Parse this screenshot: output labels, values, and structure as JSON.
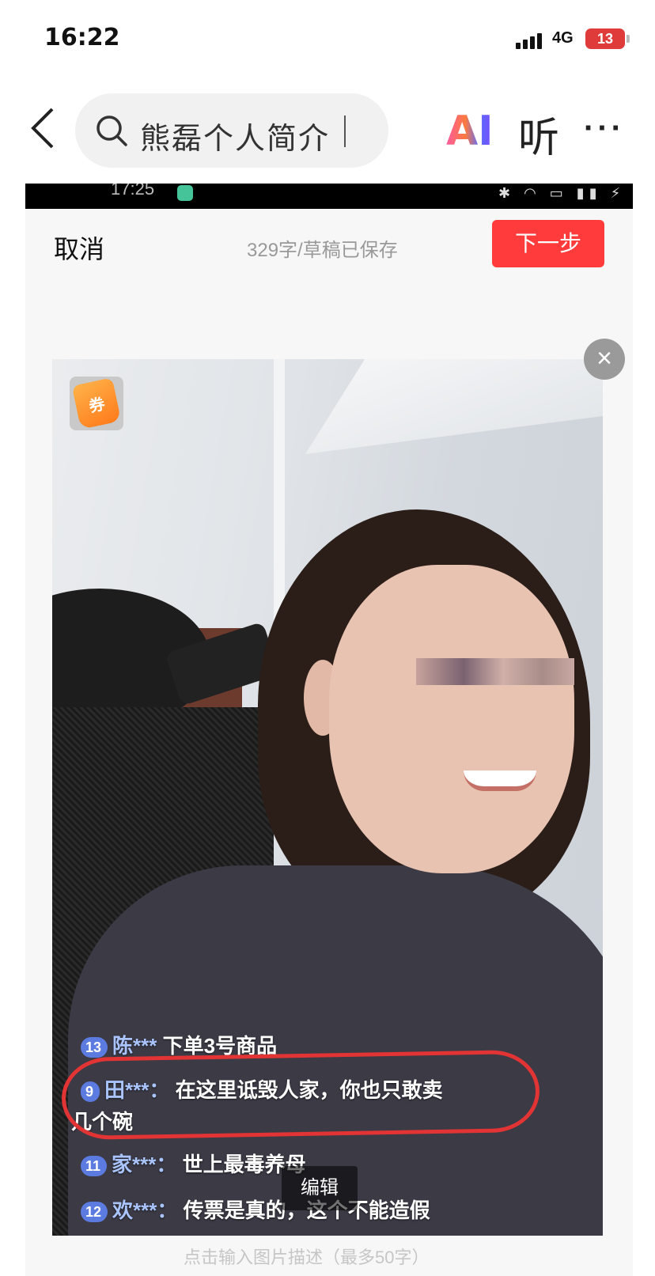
{
  "status_bar": {
    "time": "16:22",
    "network": "4G",
    "battery": "13"
  },
  "nav": {
    "search_query": "熊磊个人简介",
    "ai_label": "AI",
    "listen_label": "听",
    "more_label": "···"
  },
  "inner": {
    "status_time": "17:25",
    "cancel_label": "取消",
    "draft_status": "329字/草稿已保存",
    "next_label": "下一步",
    "close_label": "×",
    "coupon_label": "券",
    "edit_label": "编辑",
    "hint": "点击输入图片描述（最多50字）",
    "comments": [
      {
        "level": "13",
        "user": "陈***",
        "text": "下单3号商品"
      },
      {
        "level": "9",
        "user": "田***：",
        "text": "在这里诋毁人家，你也只敢卖"
      },
      {
        "level": "",
        "user": "",
        "text": "几个碗"
      },
      {
        "level": "11",
        "user": "家***：",
        "text": "世上最毒养母"
      },
      {
        "level": "12",
        "user": "欢***：",
        "text": "传票是真的，这个不能造假"
      }
    ]
  },
  "colors": {
    "next_button": "#ff3b3b",
    "highlight_circle": "#e23434",
    "level_badge": "#5b7be0"
  }
}
